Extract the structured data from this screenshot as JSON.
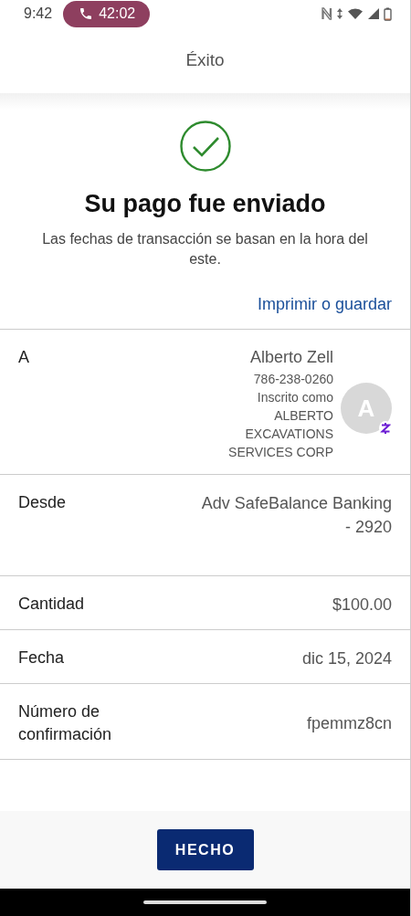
{
  "status_bar": {
    "time": "9:42",
    "call_timer": "42:02"
  },
  "header": {
    "title": "Éxito"
  },
  "confirmation": {
    "heading": "Su pago fue enviado",
    "note": "Las fechas de transacción se basan en la hora del este.",
    "print_link": "Imprimir o guardar"
  },
  "details": [
    {
      "kind": "recipient",
      "label": "A",
      "name": "Alberto Zell",
      "phone": "786-238-0260",
      "enrolled": "Inscrito como ALBERTO EXCAVATIONS SERVICES CORP",
      "avatar": "A"
    },
    {
      "kind": "plain",
      "label": "Desde",
      "value": "Adv SafeBalance Banking - 2920"
    },
    {
      "kind": "plain",
      "label": "Cantidad",
      "value": "$100.00"
    },
    {
      "kind": "plain",
      "label": "Fecha",
      "value": "dic 15, 2024"
    },
    {
      "kind": "plain",
      "label": "Número de confirmación",
      "value": "fpemmz8cn"
    }
  ],
  "footer": {
    "button": "HECHO"
  }
}
